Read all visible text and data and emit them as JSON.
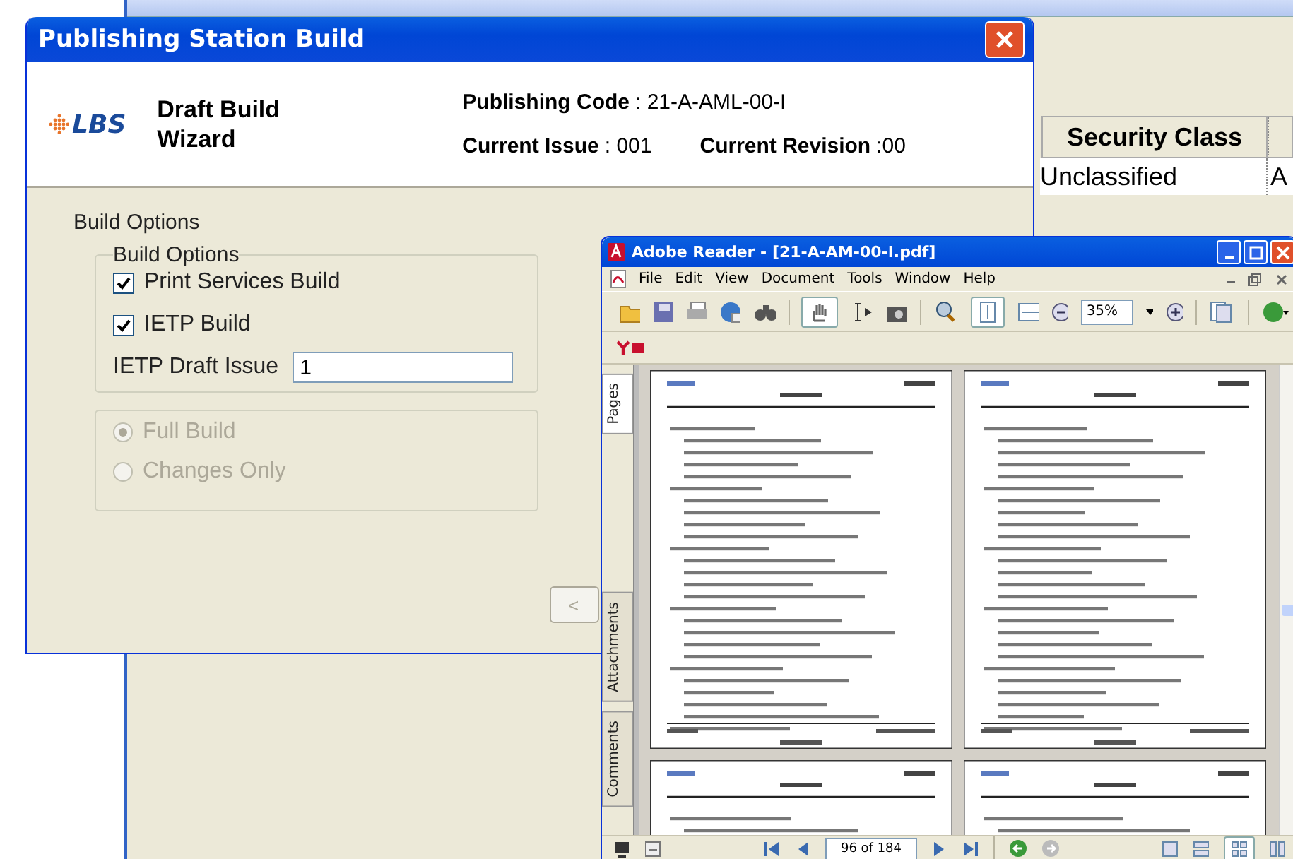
{
  "background_app": {
    "column_header": "Security Class",
    "cell": "Unclassified",
    "cut_cell": "A"
  },
  "dialog": {
    "title": "Publishing Station Build",
    "logo": "LBS",
    "wizard_title": "Draft Build Wizard",
    "publishing_code": {
      "label": "Publishing Code",
      "value": ": 21-A-AML-00-I"
    },
    "current_issue": {
      "label": "Current Issue",
      "value": ": 001"
    },
    "current_revision": {
      "label": "Current Revision",
      "value": ":00"
    },
    "section_label": "Build Options",
    "group_legend": "Build Options",
    "checkboxes": [
      {
        "label": "Print Services Build",
        "checked": true
      },
      {
        "label": "IETP Build",
        "checked": true
      }
    ],
    "draft_issue": {
      "label": "IETP Draft Issue",
      "value": "1"
    },
    "radios": [
      {
        "label": "Full Build",
        "selected": true,
        "disabled": true
      },
      {
        "label": "Changes Only",
        "selected": false,
        "disabled": true
      }
    ],
    "button": "<"
  },
  "reader": {
    "title": "Adobe Reader - [21-A-AM-00-I.pdf]",
    "menu": [
      "File",
      "Edit",
      "View",
      "Document",
      "Tools",
      "Window",
      "Help"
    ],
    "zoom": "35%",
    "side_tabs": [
      {
        "label": "Pages",
        "selected": true
      },
      {
        "label": "Attachments",
        "selected": false
      },
      {
        "label": "Comments",
        "selected": false
      }
    ],
    "page_indicator": "96 of 184"
  }
}
